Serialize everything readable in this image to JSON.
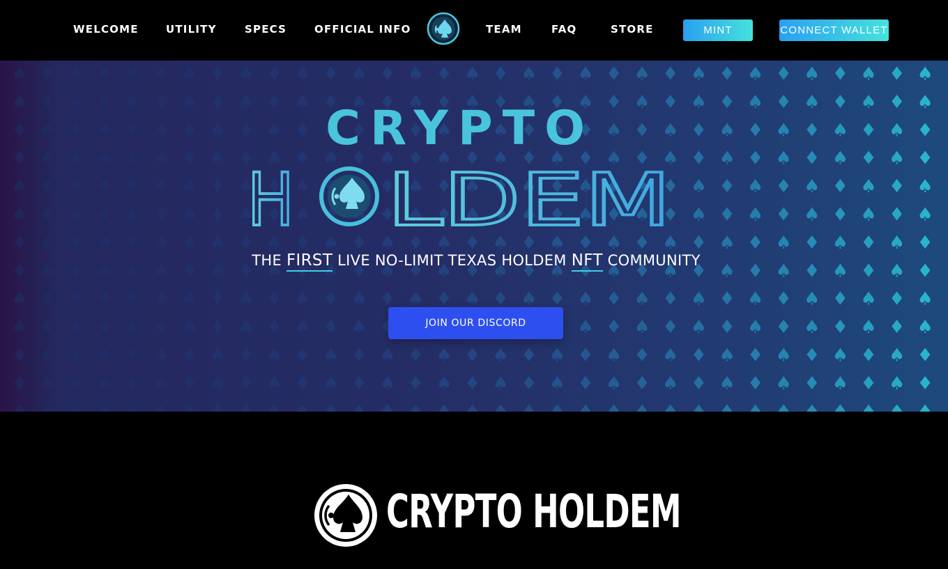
{
  "nav": {
    "links": [
      "WELCOME",
      "UTILITY",
      "SPECS",
      "OFFICIAL INFO",
      "TEAM",
      "FAQ",
      "STORE"
    ],
    "mint_label": "MINT",
    "connect_label": "CONNECT WALLET"
  },
  "hero": {
    "title_line1": "CRYPTO",
    "title_line2_parts": [
      "H",
      "LDEM"
    ],
    "tagline": {
      "part1": "THE ",
      "em1": "FIRST",
      "part2": " LIVE NO-LIMIT TEXAS HOLDEM ",
      "em2": "NFT",
      "part3": " COMMUNITY"
    },
    "discord_label": "JOIN OUR DISCORD"
  },
  "footer_brand": {
    "name": "CRYPTO HOLDEM"
  },
  "colors": {
    "accent_cyan": "#49c4dc",
    "button_blue": "#2e4ff0",
    "gradient_start": "#2aa0f0",
    "gradient_end": "#45e2dc"
  },
  "icons": {
    "logo": "spade-coin-logo-icon",
    "pattern": "card-suit-pattern"
  }
}
